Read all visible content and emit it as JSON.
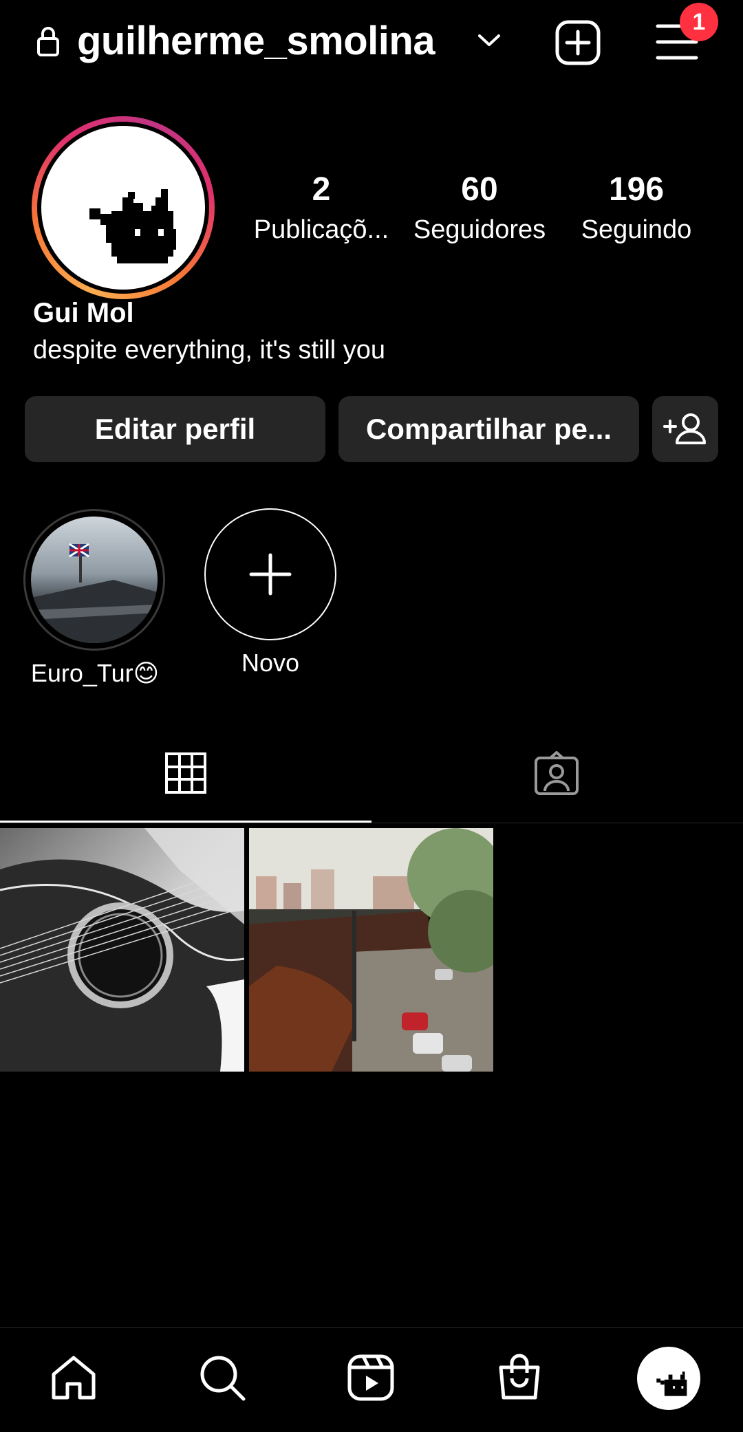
{
  "header": {
    "username": "guilherme_smolina",
    "notification_count": "1"
  },
  "profile": {
    "stats": [
      {
        "value": "2",
        "label": "Publicaçõ..."
      },
      {
        "value": "60",
        "label": "Seguidores"
      },
      {
        "value": "196",
        "label": "Seguindo"
      }
    ],
    "name": "Gui Mol",
    "bio": "despite everything, it's still you"
  },
  "actions": {
    "edit": "Editar perfil",
    "share": "Compartilhar pe..."
  },
  "highlights": [
    {
      "label": "Euro_Tur😊"
    },
    {
      "label": "Novo"
    }
  ],
  "icons": {
    "lock": "lock-icon",
    "dropdown": "chevron-down-icon",
    "create": "plus-square-icon",
    "menu": "hamburger-menu-icon",
    "add_friend": "add-person-icon",
    "grid": "grid-icon",
    "tagged": "tagged-person-icon",
    "nav": [
      "home-icon",
      "search-icon",
      "reels-icon",
      "shop-icon",
      "profile-avatar"
    ]
  },
  "colors": {
    "background": "#000000",
    "button": "#262626",
    "badge": "#ff3040",
    "story_gradient": [
      "#fbad50",
      "#e1306c",
      "#c13584"
    ]
  }
}
